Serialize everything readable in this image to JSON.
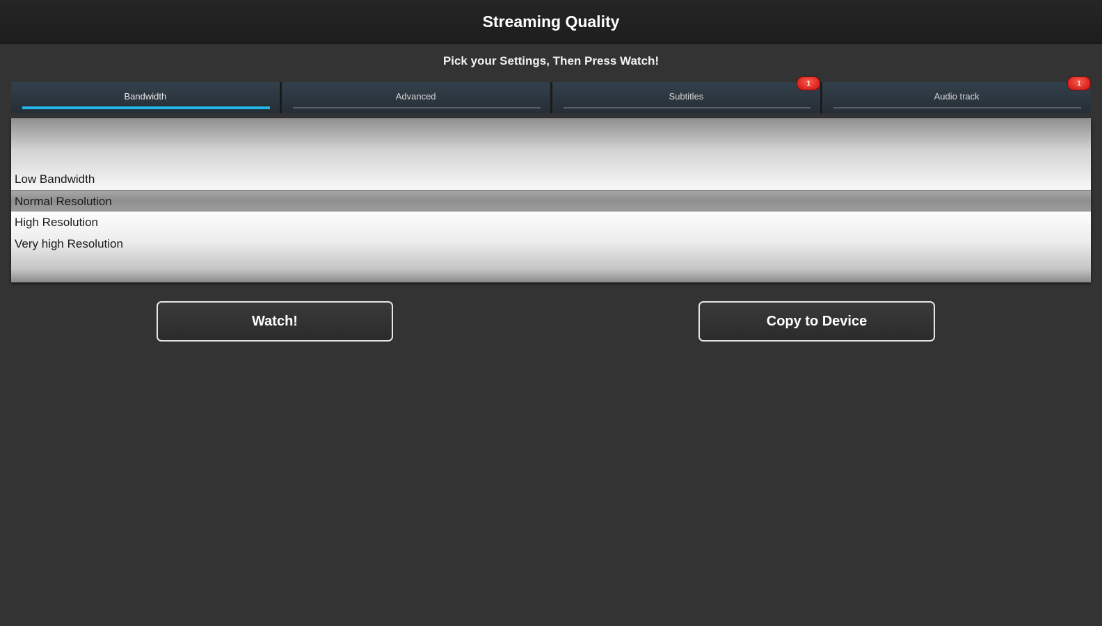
{
  "header": {
    "title": "Streaming Quality"
  },
  "instruction": "Pick your Settings, Then Press Watch!",
  "tabs": [
    {
      "label": "Bandwidth",
      "active": true,
      "badge": ""
    },
    {
      "label": "Advanced",
      "active": false,
      "badge": ""
    },
    {
      "label": "Subtitles",
      "active": false,
      "badge": "1"
    },
    {
      "label": "Audio track",
      "active": false,
      "badge": "1"
    }
  ],
  "picker": {
    "options": [
      {
        "label": "Low Bandwidth"
      },
      {
        "label": "Normal Resolution",
        "selected": true
      },
      {
        "label": "High Resolution"
      },
      {
        "label": "Very high Resolution"
      }
    ]
  },
  "buttons": {
    "watch_label": "Watch!",
    "copy_label": "Copy to Device"
  },
  "colors": {
    "accent": "#22b7e6",
    "badge": "#d81a12",
    "background": "#333333"
  }
}
